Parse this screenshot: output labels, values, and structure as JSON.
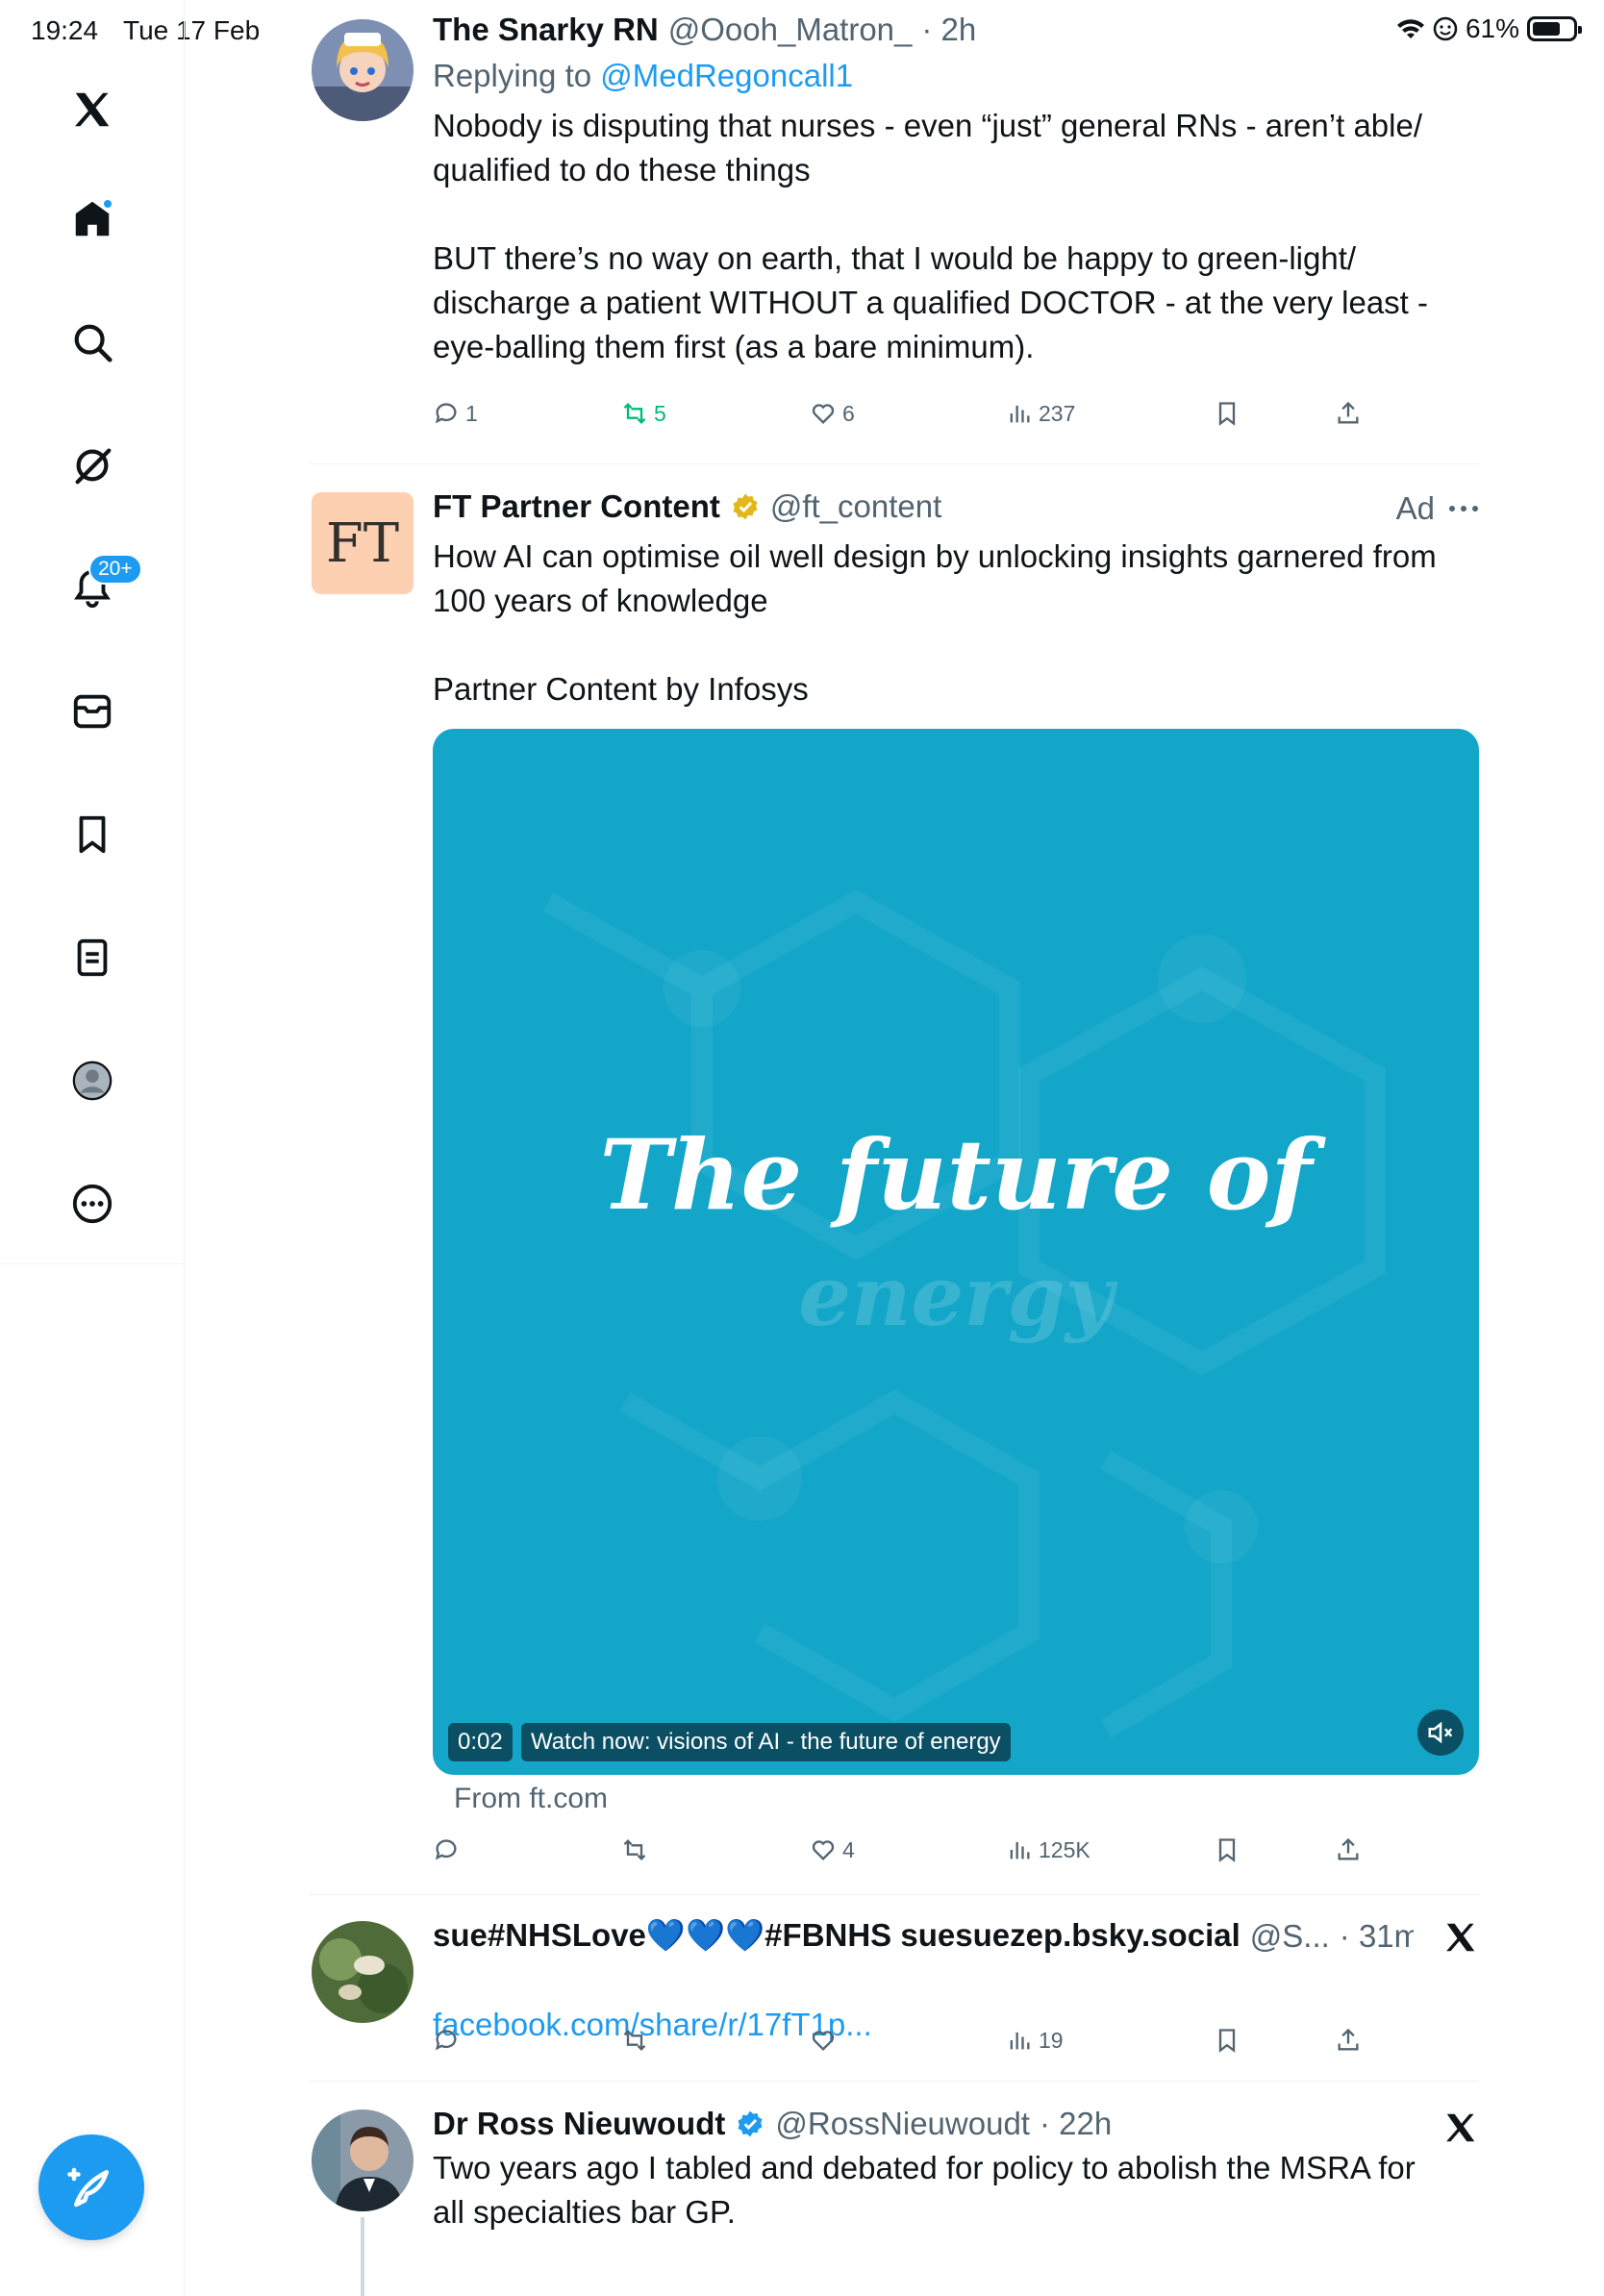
{
  "status": {
    "time": "19:24",
    "date": "Tue 17 Feb",
    "battery": "61%"
  },
  "sidebar": {
    "items": [
      {
        "name": "x-logo-icon"
      },
      {
        "name": "home-icon"
      },
      {
        "name": "search-icon"
      },
      {
        "name": "grok-icon"
      },
      {
        "name": "notifications-icon",
        "badge": "20+"
      },
      {
        "name": "messages-icon"
      },
      {
        "name": "bookmarks-icon"
      },
      {
        "name": "lists-icon"
      },
      {
        "name": "profile-icon"
      },
      {
        "name": "more-icon"
      }
    ],
    "compose": "compose-icon"
  },
  "tweets": [
    {
      "name": "The Snarky RN",
      "handle": "@Oooh_Matron_",
      "time": "· 2h",
      "replying_prefix": "Replying to",
      "replying_to": "@MedRegoncall1",
      "text": "Nobody is disputing that nurses - even “just” general RNs - aren’t able/\nqualified to do these things\n\nBUT there’s no way on earth, that I would be happy to green-light/\ndischarge a patient WITHOUT a qualified DOCTOR - at the very least -\neye-balling them first (as a bare minimum).",
      "replies": "1",
      "retweets": "5",
      "likes": "6",
      "views": "237"
    },
    {
      "name": "FT Partner Content",
      "handle": "@ft_content",
      "ad_label": "Ad",
      "avatar_text": "FT",
      "text": "How AI can optimise oil well design by unlocking insights garnered from\n100 years of knowledge\n\nPartner Content by Infosys",
      "media_title": "The future of",
      "media_sub": "energy",
      "video_time": "0:02",
      "video_caption": "Watch now: visions of AI - the future of energy",
      "from": "From ft.com",
      "replies": "",
      "retweets": "",
      "likes": "4",
      "views": "125K"
    },
    {
      "name": "sue#NHSLove💙💙💙#FBNHS suesuezep.bsky.social",
      "handle": "@S...",
      "time": "· 31m",
      "link": "facebook.com/share/r/17fT1p...",
      "replies": "",
      "retweets": "",
      "likes": "",
      "views": "19"
    },
    {
      "name": "Dr Ross Nieuwoudt",
      "handle": "@RossNieuwoudt",
      "time": "· 22h",
      "text": "Two years ago I tabled and debated for policy to abolish the MSRA for\nall specialties bar GP."
    }
  ],
  "colors": {
    "accent": "#1d9bf0",
    "retweet_green": "#00ba7c",
    "media_bg": "#13a6c9"
  }
}
